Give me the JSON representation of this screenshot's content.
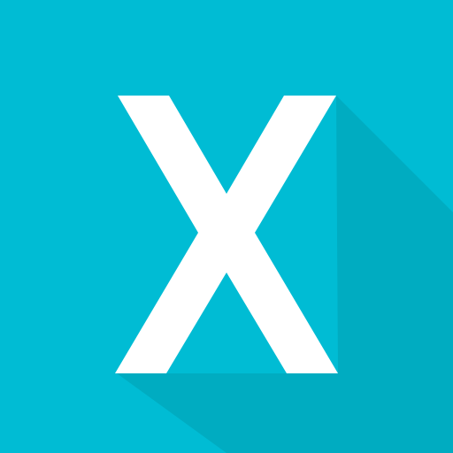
{
  "icon": {
    "letter": "X",
    "name": "letter-x-icon",
    "colors": {
      "background": "#00BCD4",
      "long_shadow": "#00ACC1",
      "glyph": "#FFFFFF"
    }
  }
}
